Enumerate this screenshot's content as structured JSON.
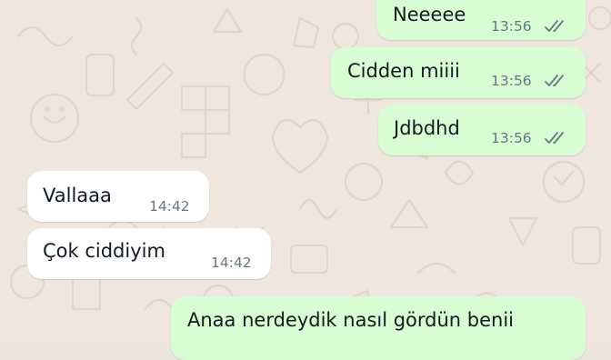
{
  "chat": {
    "outgoing_1": {
      "text": "Neeeee",
      "time": "13:56",
      "status_icon": "double-check-icon"
    },
    "outgoing_2": {
      "text": "Cidden miiii",
      "time": "13:56",
      "status_icon": "double-check-icon"
    },
    "outgoing_3": {
      "text": "Jdbdhd",
      "time": "13:56",
      "status_icon": "double-check-icon"
    },
    "incoming_1": {
      "text": "Vallaaa",
      "time": "14:42"
    },
    "incoming_2": {
      "text": "Çok ciddiyim",
      "time": "14:42"
    },
    "outgoing_4": {
      "text": "Anaa nerdeydik nasıl gördün benii"
    }
  },
  "colors": {
    "wallpaper": "#efe7de",
    "outgoing_bubble": "#d9fdd3",
    "incoming_bubble": "#ffffff",
    "message_text": "#111b21",
    "timestamp": "#667781",
    "tick_color": "#667781"
  }
}
